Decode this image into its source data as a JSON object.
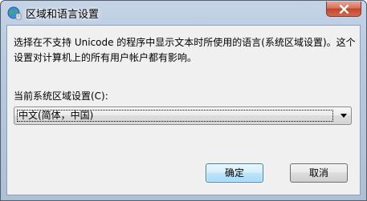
{
  "window": {
    "title": "区域和语言设置"
  },
  "content": {
    "description": "选择在不支持 Unicode 的程序中显示文本时所使用的语言(系统区域设置)。这个设置对计算机上的所有用户帐户都有影响。",
    "locale_label": "当前系统区域设置(C):",
    "locale_value": "中文(简体，中国)"
  },
  "buttons": {
    "ok": "确定",
    "cancel": "取消"
  },
  "icons": {
    "title": "globe-icon",
    "close": "close-icon",
    "dropdown": "chevron-down-icon"
  },
  "colors": {
    "title_bar": "#b9cae0",
    "close_button": "#c4442c",
    "default_button_border": "#3c7fb1",
    "dialog_background": "#f0f0f0"
  }
}
